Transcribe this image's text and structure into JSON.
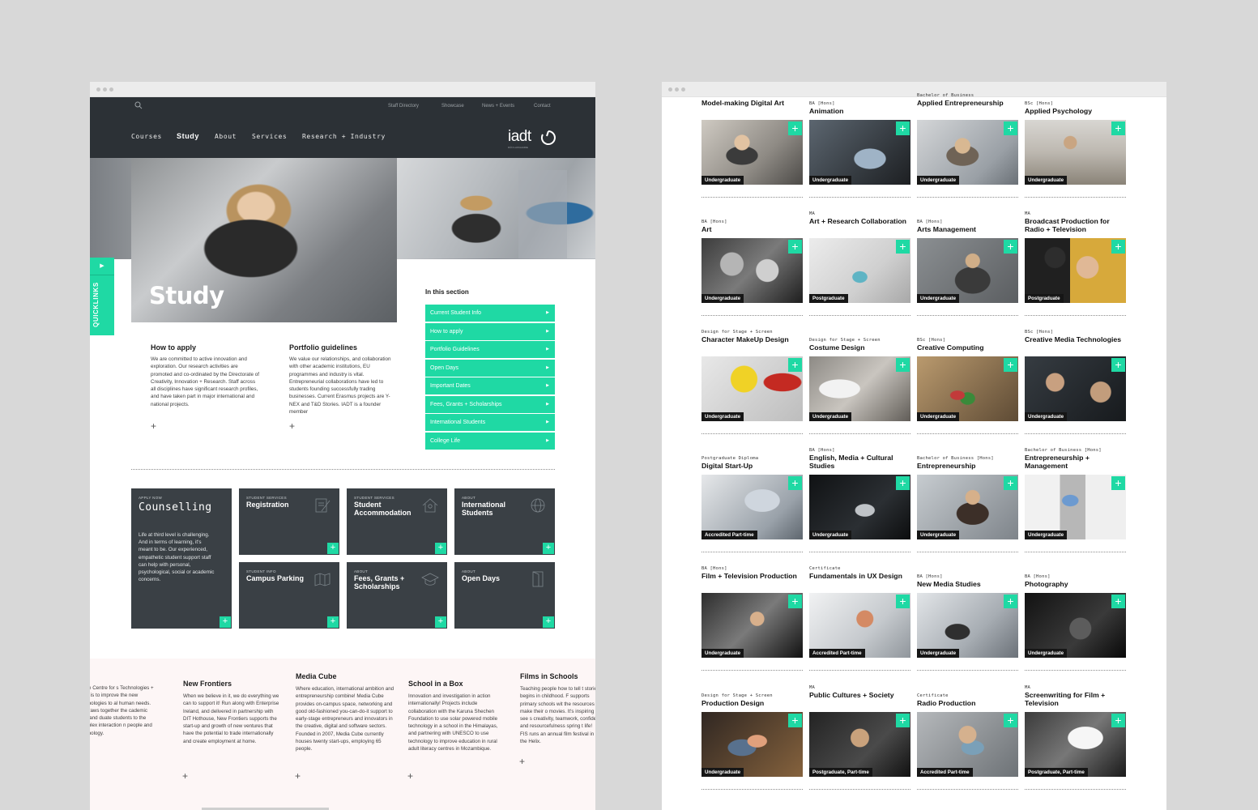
{
  "left": {
    "util_nav": [
      "Staff Directory",
      "Showcase",
      "News + Events",
      "Contact"
    ],
    "main_nav": [
      "Courses",
      "Study",
      "About",
      "Services",
      "Research + Industry"
    ],
    "logo": {
      "word": "iadt",
      "sub": "DÚN LAOGHAIRE"
    },
    "hero_title": "Study",
    "quicklinks": "QUICKLINKS",
    "in_section": {
      "title": "In this section",
      "items": [
        "Current Student Info",
        "How to apply",
        "Portfolio Guidelines",
        "Open Days",
        "Important Dates",
        "Fees, Grants + Scholarships",
        "International Students",
        "College Life"
      ]
    },
    "intro": [
      {
        "title": "How to apply",
        "text": "We are committed to active innovation and exploration. Our research activities are promoted and co-ordinated by the Directorate of Creativity, Innovation + Research. Staff across all disciplines have significant research profiles, and have taken part in major international and national projects."
      },
      {
        "title": "Portfolio guidelines",
        "text": "We value our relationships, and collaboration with other academic institutions, EU programmes and industry is vital. Entrepreneurial collaborations have led to students founding successfully trading businesses. Current Erasmus projects are Y-NEX and T&D Stories. IADT is a founder member"
      }
    ],
    "tiles": [
      {
        "cat": "APPLY NOW",
        "title": "Counselling",
        "desc": "Life at third level is challenging. And in terms of learning, it's meant to be. Our experienced, empathetic student support staff can help with personal, psychological, social or academic concerns.",
        "icon": ""
      },
      {
        "cat": "STUDENT SERVICES",
        "title": "Registration",
        "icon": "document-pen-icon"
      },
      {
        "cat": "STUDENT SERVICES",
        "title": "Student Accommodation",
        "icon": "house-icon"
      },
      {
        "cat": "ABOUT",
        "title": "International Students",
        "icon": "globe-people-icon"
      },
      {
        "cat": "STUDENT INFO",
        "title": "Campus Parking",
        "icon": "map-pin-icon"
      },
      {
        "cat": "ABOUT",
        "title": "Fees, Grants + Scholarships",
        "icon": "graduation-cap-icon"
      },
      {
        "cat": "ABOUT",
        "title": "Open Days",
        "icon": "door-icon"
      }
    ],
    "news": [
      {
        "title": "",
        "text": "of the Centre for s Technologies + tions is to improve the new technologies to al human needs. The raws together the cademic staff and duate students to the complex interaction n people and technology."
      },
      {
        "title": "New Frontiers",
        "text": "When we believe in it, we do everything we can to support it! Run along with Enterprise Ireland, and delivered in partnership with DIT Hothouse, New Frontiers supports the start-up and growth of new ventures that have the potential to trade internationally and create employment at home."
      },
      {
        "title": "Media Cube",
        "text": "Where education, international ambition and entrepreneurship combine! Media Cube provides on-campus space, networking and good old-fashioned you-can-do-it support to early-stage entrepreneurs and innovators in the creative, digital and software sectors. Founded in 2007, Media Cube currently houses twenty start-ups, employing 65 people."
      },
      {
        "title": "School in a Box",
        "text": "Innovation and investigation in action internationally! Projects include collaboration with the Karuna Shechen Foundation to use solar powered mobile technology in a school in the Himalayas, and partnering with UNESCO to use technology to improve education in rural adult literacy centres in Mozambique."
      },
      {
        "title": "Films in Schools",
        "text": "Teaching people how to tell t stories begins in childhood. F supports primary schools wit the resources to make their o movies. It's inspiring to see s creativity, teamwork, confide and resourcefulness spring t life! FIS runs an annual film festival in the Helix."
      }
    ]
  },
  "right": {
    "courses": [
      {
        "pre": "",
        "name": "Model-making Digital Art",
        "badge": "Undergraduate"
      },
      {
        "pre": "BA [Hons]",
        "name": "Animation",
        "badge": "Undergraduate"
      },
      {
        "pre": "Bachelor of Business",
        "name": "Applied Entrepreneurship",
        "badge": "Undergraduate"
      },
      {
        "pre": "BSc [Hons]",
        "name": "Applied Psychology",
        "badge": "Undergraduate"
      },
      {
        "pre": "BA [Hons]",
        "name": "Art",
        "badge": "Undergraduate"
      },
      {
        "pre": "MA",
        "name": "Art + Research Collaboration",
        "badge": "Postgraduate"
      },
      {
        "pre": "BA [Hons]",
        "name": "Arts Management",
        "badge": "Undergraduate"
      },
      {
        "pre": "MA",
        "name": "Broadcast Production for Radio + Television",
        "badge": "Postgraduate"
      },
      {
        "pre": "Design for Stage + Screen",
        "name": "Character MakeUp Design",
        "badge": "Undergraduate"
      },
      {
        "pre": "Design for Stage + Screen",
        "name": "Costume Design",
        "badge": "Undergraduate"
      },
      {
        "pre": "BSc [Hons]",
        "name": "Creative Computing",
        "badge": "Undergraduate"
      },
      {
        "pre": "BSc [Hons]",
        "name": "Creative Media Technologies",
        "badge": "Undergraduate"
      },
      {
        "pre": "Postgraduate Diploma",
        "name": "Digital Start-Up",
        "badge": "Accredited Part-time"
      },
      {
        "pre": "BA [Hons]",
        "name": "English, Media + Cultural Studies",
        "badge": "Undergraduate"
      },
      {
        "pre": "Bachelor of Business [Hons]",
        "name": "Entrepreneurship",
        "badge": "Undergraduate"
      },
      {
        "pre": "Bachelor of Business [Hons]",
        "name": "Entrepreneurship + Management",
        "badge": "Undergraduate"
      },
      {
        "pre": "BA [Hons]",
        "name": "Film + Television Production",
        "badge": "Undergraduate"
      },
      {
        "pre": "Certificate",
        "name": "Fundamentals in UX Design",
        "badge": "Accredited Part-time"
      },
      {
        "pre": "BA [Hons]",
        "name": "New Media Studies",
        "badge": "Undergraduate"
      },
      {
        "pre": "BA [Hons]",
        "name": "Photography",
        "badge": "Undergraduate"
      },
      {
        "pre": "Design for Stage + Screen",
        "name": "Production Design",
        "badge": "Undergraduate"
      },
      {
        "pre": "MA",
        "name": "Public Cultures + Society",
        "badge": "Postgraduate, Part-time"
      },
      {
        "pre": "Certificate",
        "name": "Radio Production",
        "badge": "Accredited Part-time"
      },
      {
        "pre": "MA",
        "name": "Screenwriting for Film + Television",
        "badge": "Postgraduate, Part-time"
      }
    ]
  },
  "colors": {
    "accent": "#1fd9a4",
    "nav_bg": "#2c3136",
    "tile_bg": "#3a4045"
  }
}
